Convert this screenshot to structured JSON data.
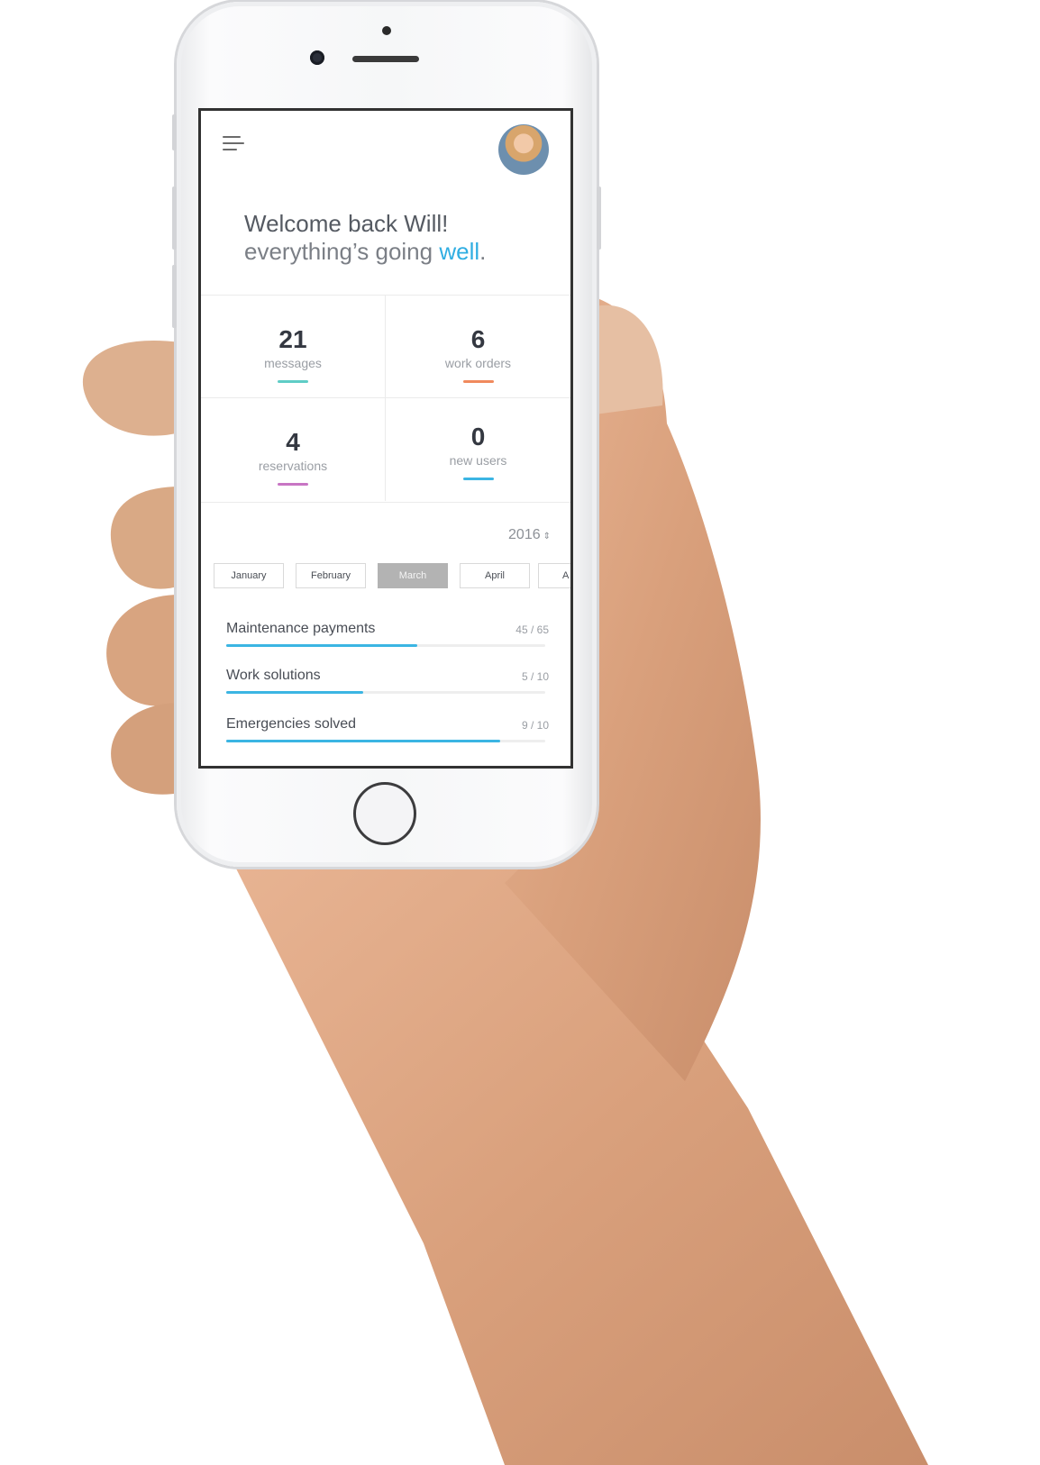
{
  "header": {
    "welcome_line1": "Welcome back Will!",
    "welcome_line2_prefix": "everything’s going ",
    "welcome_line2_accent": "well",
    "welcome_line2_suffix": "."
  },
  "stats": [
    {
      "value": "21",
      "label": "messages",
      "color": "#5fcdc6"
    },
    {
      "value": "6",
      "label": "work orders",
      "color": "#f08a5d"
    },
    {
      "value": "4",
      "label": "reservations",
      "color": "#c875c4"
    },
    {
      "value": "0",
      "label": "new users",
      "color": "#3bb5e3"
    }
  ],
  "year": {
    "label": "2016",
    "icon": "sort-arrows-icon"
  },
  "months": [
    {
      "label": "January",
      "active": false
    },
    {
      "label": "February",
      "active": false
    },
    {
      "label": "March",
      "active": true
    },
    {
      "label": "April",
      "active": false
    },
    {
      "label": "A",
      "active": false
    }
  ],
  "progress": [
    {
      "title": "Maintenance payments",
      "count": "45 / 65",
      "fraction": 0.6
    },
    {
      "title": "Work solutions",
      "count": "5 / 10",
      "fraction": 0.43
    },
    {
      "title": "Emergencies solved",
      "count": "9 / 10",
      "fraction": 0.86
    }
  ],
  "colors": {
    "accent": "#30aee2",
    "progress_fill": "#3bb5e3"
  }
}
